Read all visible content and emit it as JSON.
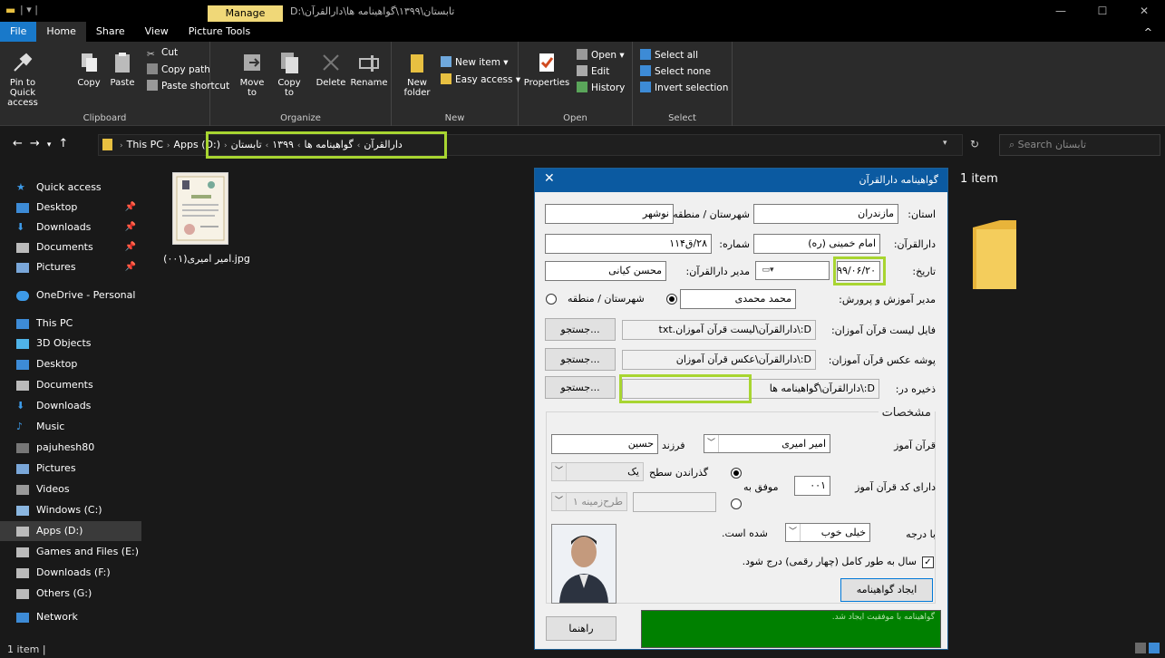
{
  "titlebar": {
    "manage_tab": "Manage",
    "path_title": "D:\\تابستان\\۱۳۹۹\\گواهینامه ها\\دارالقرآن",
    "minimize": "—",
    "maximize": "☐",
    "close": "✕"
  },
  "ribbon_tabs": [
    "File",
    "Home",
    "Share",
    "View",
    "Picture Tools"
  ],
  "ribbon": {
    "clipboard": {
      "label": "Clipboard",
      "pin": "Pin to Quick access",
      "copy": "Copy",
      "paste": "Paste",
      "cut": "Cut",
      "copy_path": "Copy path",
      "paste_shortcut": "Paste shortcut"
    },
    "organize": {
      "label": "Organize",
      "move_to": "Move to",
      "copy_to": "Copy to",
      "delete": "Delete",
      "rename": "Rename"
    },
    "new": {
      "label": "New",
      "new_folder": "New folder",
      "new_item": "New item",
      "easy_access": "Easy access"
    },
    "open": {
      "label": "Open",
      "properties": "Properties",
      "open": "Open",
      "edit": "Edit",
      "history": "History"
    },
    "select": {
      "label": "Select",
      "select_all": "Select all",
      "select_none": "Select none",
      "invert": "Invert selection"
    }
  },
  "address": {
    "crumbs": [
      "This PC",
      "Apps (D:)",
      "دارالقرآن",
      "گواهینامه ها",
      "۱۳۹۹",
      "تابستان"
    ],
    "search_placeholder": "Search تابستان"
  },
  "nav": {
    "quick_access": "Quick access",
    "qa_items": [
      "Desktop",
      "Downloads",
      "Documents",
      "Pictures"
    ],
    "onedrive": "OneDrive - Personal",
    "this_pc": "This PC",
    "pc_items": [
      "3D Objects",
      "Desktop",
      "Documents",
      "Downloads",
      "Music",
      "pajuhesh80",
      "Pictures",
      "Videos",
      "Windows (C:)",
      "Apps (D:)",
      "Games and Files (E:)",
      "Downloads (F:)",
      "Others (G:)"
    ],
    "network": "Network"
  },
  "files": {
    "thumb_label": "امیر امیری(۰۰۱).jpg",
    "item_count": "1 item"
  },
  "status": {
    "text": "1 item  |"
  },
  "dialog": {
    "title": "گواهینامه دارالقرآن",
    "close": "✕",
    "province_label": "استان:",
    "province_value": "مازندران",
    "city_label": "شهرستان / منطقه:",
    "city_value": "نوشهر",
    "quran_house_label": "دارالقرآن:",
    "quran_house_value": "امام خمینی (ره)",
    "number_label": "شماره:",
    "number_value": "۲۸/ق۱۱۴",
    "date_label": "تاریخ:",
    "date_value": "۱۳۹۹/۰۶/۲۰",
    "manager_label": "مدیر دارالقرآن:",
    "manager_value": "محسن کیانی",
    "edu_manager_label": "مدیر آموزش و پرورش:",
    "edu_manager_value": "محمد محمدی",
    "radio_city": "شهرستان / منطقه",
    "list_file_label": "فایل لیست قرآن آموزان:",
    "list_file_value": "D:\\دارالقرآن\\لیست قرآن آموزان.txt",
    "photo_folder_label": "پوشه عکس قرآن آموزان:",
    "photo_folder_value": "D:\\دارالقرآن\\عکس قرآن آموزان",
    "save_label": "ذخیره در:",
    "save_value": "D:\\دارالقرآن\\گواهینامه ها",
    "browse": "جستجو...",
    "specs_title": "مشخصات",
    "student_label": "قرآن آموز",
    "student_value": "امیر امیری",
    "child_label": "فرزند",
    "father_value": "حسین",
    "has_code_label": "دارای کد قرآن آموز",
    "code_value": "۰۰۱",
    "success_label": "موفق به",
    "pass_level_label": "گذراندن سطح",
    "level_value": "یک",
    "design_value": "طرح‌زمینه ۱",
    "grade_label": "با درجه",
    "grade_value": "خیلی خوب",
    "grade_suffix": "شده است.",
    "full_year_label": "سال به طور کامل (چهار رقمی) درج شود.",
    "create_button": "ایجاد گواهینامه",
    "help_button": "راهنما",
    "status_message": "گواهینامه با موفقیت ایجاد شد."
  },
  "colors": {
    "highlight": "#a8d531",
    "dialog_title": "#0b5aa1",
    "status_green": "#008000",
    "file_tab": "#1979ca"
  }
}
